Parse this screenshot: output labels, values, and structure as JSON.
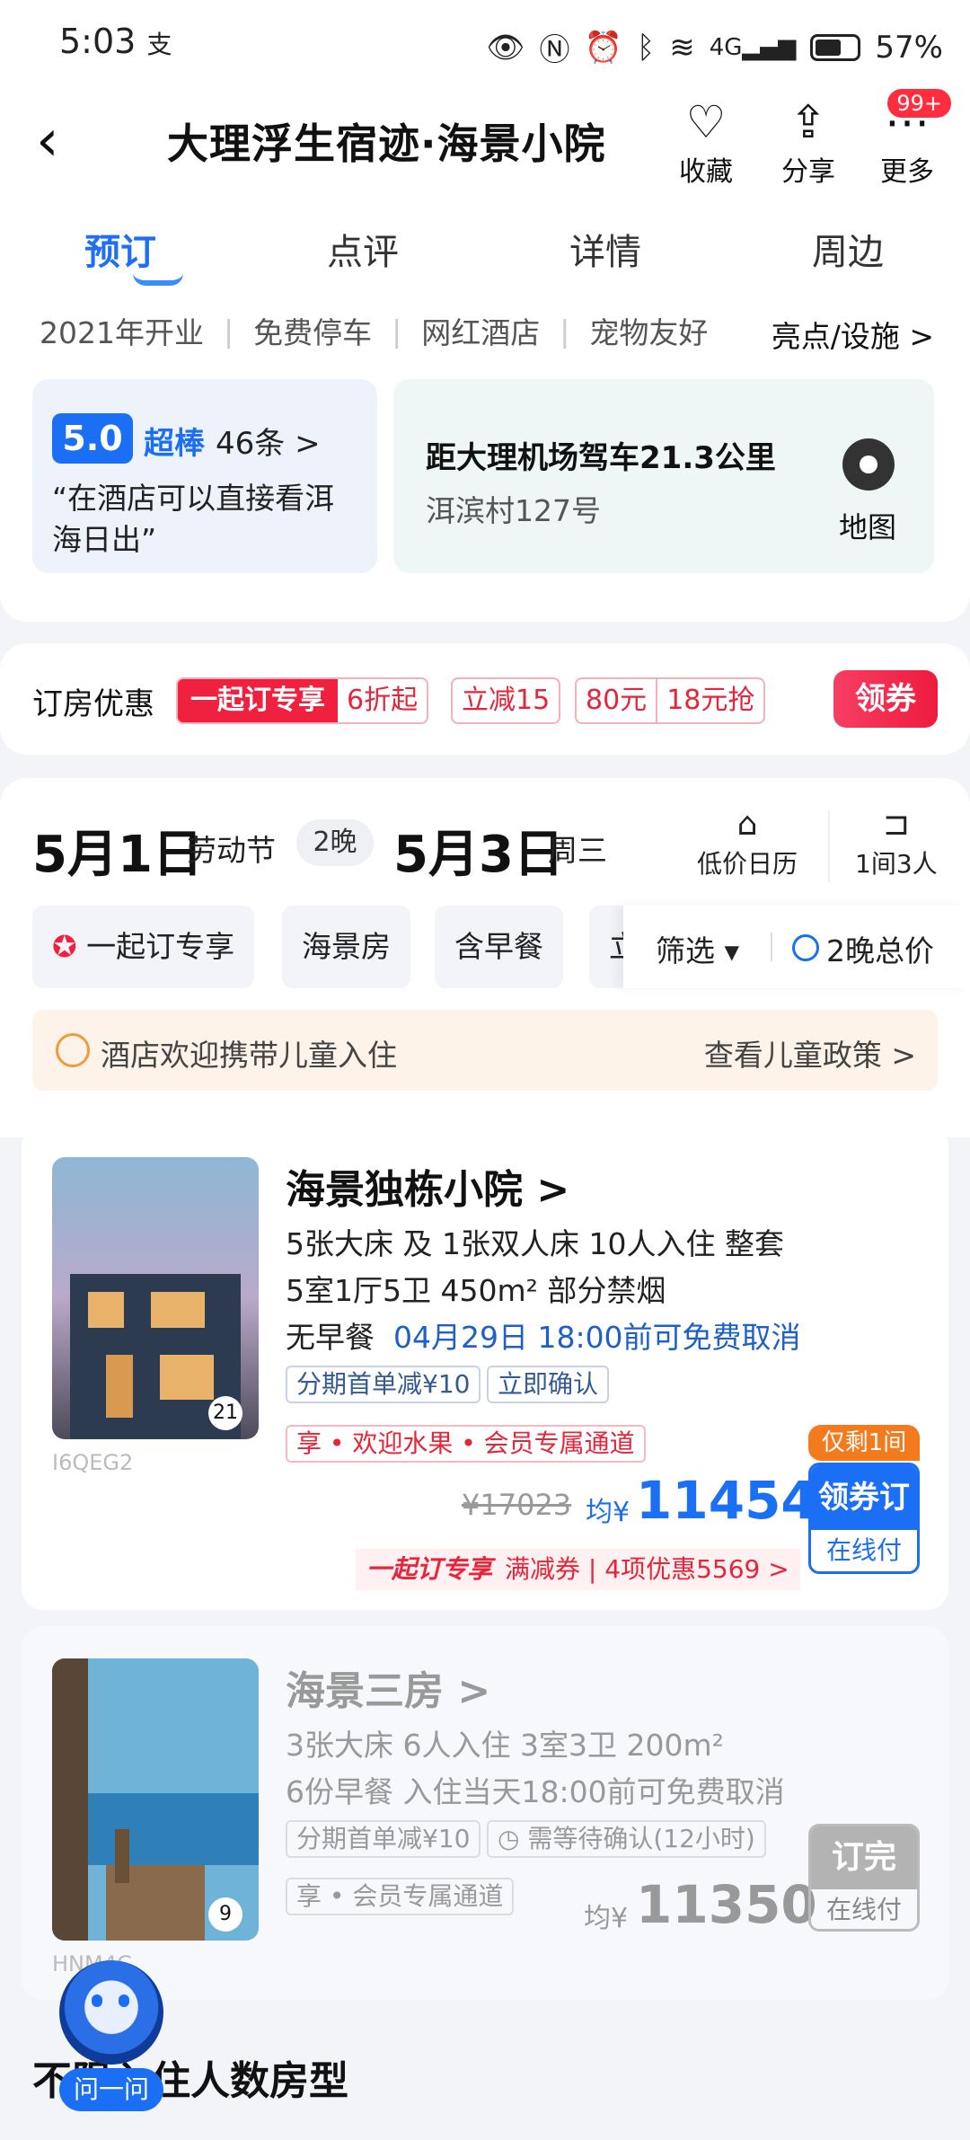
{
  "status": {
    "time": "5:03",
    "time_suffix": "支",
    "battery": "57%"
  },
  "header": {
    "back_label": "<",
    "title": "大理浮生宿迹·海景小院",
    "favorite_label": "收藏",
    "share_label": "分享",
    "more_label": "更多",
    "more_badge": "99+"
  },
  "tabs": [
    {
      "label": "预订",
      "active": true
    },
    {
      "label": "点评"
    },
    {
      "label": "详情"
    },
    {
      "label": "周边"
    }
  ],
  "hotel_tags": [
    "2021年开业",
    "免费停车",
    "网红酒店",
    "宠物友好"
  ],
  "highlights_label": "亮点/设施 >",
  "review": {
    "score": "5.0",
    "level": "超棒",
    "count": "46条 >",
    "quote": "“在酒店可以直接看洱海日出”"
  },
  "location": {
    "distance": "距大理机场驾车21.3公里",
    "address": "洱滨村127号",
    "map_label": "地图"
  },
  "coupon": {
    "label": "订房优惠",
    "tag1_main": "一起订专享",
    "tag1_sub": "6折起",
    "tag2": "立减15",
    "tag3_a": "80元",
    "tag3_b": "18元抢",
    "get_label": "领券"
  },
  "dates": {
    "checkin": "5月1日",
    "checkin_note": "劳动节",
    "nights": "2晚",
    "checkout": "5月3日",
    "checkout_note": "周三",
    "calendar_label": "低价日历",
    "rooms_label": "1间3人"
  },
  "filters": {
    "chip1": "一起订专享",
    "chip2": "海景房",
    "chip3": "含早餐",
    "chip4": "立",
    "filter_label": "筛选 ▾",
    "total_label": "2晚总价"
  },
  "child_policy": {
    "text": "酒店欢迎携带儿童入住",
    "link": "查看儿童政策 >"
  },
  "rooms": [
    {
      "name": "海景独栋小院 >",
      "photo_count": "21",
      "code": "I6QEG2",
      "line1": "5张大床 及 1张双人床   10人入住   整套",
      "line2": "5室1厅5卫   450m²   部分禁烟",
      "line3_a": "无早餐",
      "line3_b": "04月29日 18:00前可免费取消",
      "tag_a": "分期首单减¥10",
      "tag_b": "立即确认",
      "tag_c": "享 • 欢迎水果 • 会员专属通道",
      "orig_price": "¥17023",
      "avg_label": "均¥",
      "price": "11454",
      "promo_brand": "一起订专享",
      "promo_a": "满减券",
      "promo_b": "4项优惠5569 >",
      "remaining": "仅剩1间",
      "btn_top": "领券订",
      "btn_bot": "在线付"
    },
    {
      "name": "海景三房 >",
      "photo_count": "9",
      "code": "HNM4C",
      "line1": "3张大床   6人入住   3室3卫   200m²",
      "line2": "6份早餐   入住当天18:00前可免费取消",
      "tag_a": "分期首单减¥10",
      "tag_b": "需等待确认(12小时)",
      "tag_c": "享 • 会员专属通道",
      "avg_label": "均¥",
      "price": "11350",
      "btn_top": "订完",
      "btn_bot": "在线付"
    }
  ],
  "bottom_title": "不限入住人数房型",
  "assistant_label": "问一问"
}
